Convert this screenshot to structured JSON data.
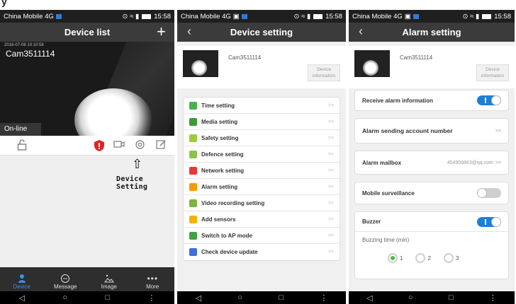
{
  "caption": "y",
  "status": {
    "carrier1": "China Mobile 4G",
    "carrier2": "China Mobile 4G",
    "time": "15:58"
  },
  "panel1": {
    "title": "Device list",
    "camera_name": "Cam3511114",
    "camera_timestamp": "2016-07-08 10:10:58",
    "status_label": "On-line",
    "callout": "Device Setting",
    "nav": [
      "Device",
      "Message",
      "Image",
      "More"
    ]
  },
  "panel2": {
    "title": "Device setting",
    "device_name": "Cam3511114",
    "device_info": "Device information",
    "menu": [
      {
        "label": "Time setting",
        "icon": "clock-icon",
        "color": "#4caf50"
      },
      {
        "label": "Media setting",
        "icon": "media-icon",
        "color": "#3c9a3c"
      },
      {
        "label": "Safety setting",
        "icon": "shield-icon",
        "color": "#9ccc3c"
      },
      {
        "label": "Defence setting",
        "icon": "defence-icon",
        "color": "#8bc34a"
      },
      {
        "label": "Network setting",
        "icon": "antenna-icon",
        "color": "#e53935"
      },
      {
        "label": "Alarm setting",
        "icon": "alarm-person-icon",
        "color": "#ff9800"
      },
      {
        "label": "Video recording setting",
        "icon": "video-record-icon",
        "color": "#7cb342"
      },
      {
        "label": "Add sensors",
        "icon": "sensor-icon",
        "color": "#f0b400"
      },
      {
        "label": "Switch to AP mode",
        "icon": "ap-mode-icon",
        "color": "#43a047"
      },
      {
        "label": "Check device update",
        "icon": "update-icon",
        "color": "#3f6fd8"
      }
    ],
    "chevron": ">>"
  },
  "panel3": {
    "title": "Alarm setting",
    "device_name": "Cam3511114",
    "device_info": "Device information",
    "receive_alarm": "Receive alarm information",
    "sending_account": "Alarm sending account number",
    "alarm_mailbox": "Alarm mailbox",
    "mailbox_value": "454959863@qq.com",
    "mobile_surveillance": "Mobile surveillance",
    "buzzer": "Buzzer",
    "buzzing_time": "Buzzing time (min)",
    "radio_options": [
      "1",
      "2",
      "3"
    ],
    "chevron": ">>"
  }
}
